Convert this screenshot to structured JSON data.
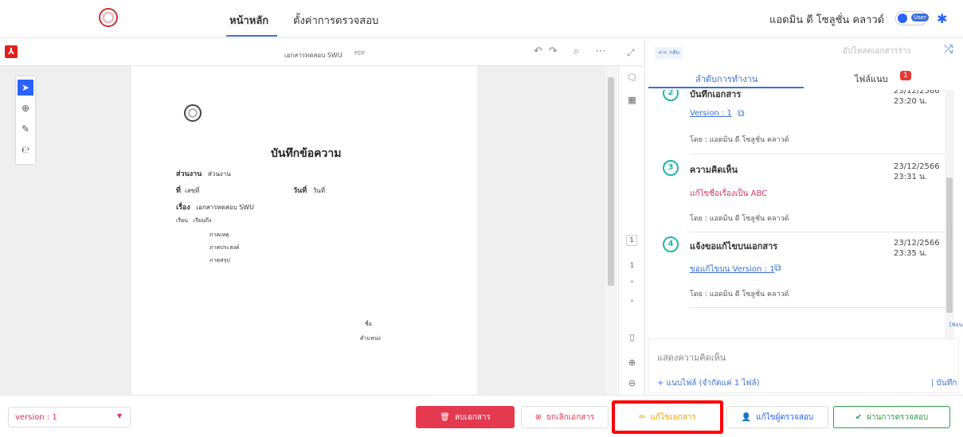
{
  "nav": {
    "home": "หน้าหลัก",
    "settings": "ตั้งค่าการตรวจสอบ",
    "user": "แอดมิน ดี โซลูชั่น คลาวด์",
    "toggle": "User"
  },
  "pdf": {
    "title": "เอกสารทดสอบ SWU",
    "ext": "PDF"
  },
  "doc": {
    "heading": "บันทึกข้อความ",
    "dept_label": "ส่วนงาน",
    "dept_value": "ส่วนงาน",
    "no_label": "ที่",
    "no_value": "เลขที่",
    "date_label": "วันที่",
    "date_value": "วันที่",
    "subject_label": "เรื่อง",
    "subject_value": "เอกสารทดสอบ SWU",
    "to_label": "เรียน",
    "to_value": "เรียนถึง",
    "intro": "ภาคเหตุ",
    "purpose": "ภาคประสงค์",
    "summary": "ภาคสรุป",
    "sign": "ชื่อ",
    "position": "ตำแหน่ง"
  },
  "viewer": {
    "page_num": "1",
    "page_total": "1"
  },
  "right": {
    "back": "<< กลับ",
    "upload_draft": "อัปโหลดเอกสารร่าง",
    "tab_order": "ลำดับการทำงาน",
    "tab_files": "ไฟล์แนบ",
    "files_count": "1",
    "timeline": [
      {
        "num": "2",
        "title": "บันทึกเอกสาร",
        "time": "23/12/2566 23:20 น.",
        "link": "Version : 1",
        "by": "โดย : แอดมิน ดี โซลูชั่น คลาวด์"
      },
      {
        "num": "3",
        "title": "ความคิดเห็น",
        "time": "23/12/2566 23:31 น.",
        "comment": "แก้ไขชื่อเรื่องเป็น ABC",
        "by": "โดย : แอดมิน ดี โซลูชั่น คลาวด์"
      },
      {
        "num": "4",
        "title": "แจ้งขอแก้ไขบนเอกสาร",
        "time": "23/12/2566 23:35 น.",
        "link": "ขอแก้ไขบน Version : 1",
        "by": "โดย : แอดมิน ดี โซลูชั่น คลาวด์"
      }
    ],
    "hide": "[ซ่อน]",
    "comment_placeholder": "แสดงความคิดเห็น",
    "attach": "+  แนบไฟล์ (จำกัดแค่ 1 ไฟล์)",
    "save": "|  บันทึก"
  },
  "bottom": {
    "version": "version : 1",
    "delete": "ลบเอกสาร",
    "cancel": "ยกเลิกเอกสาร",
    "edit": "แก้ไขเอกสาร",
    "edit_reviewer": "แก้ไขผู้ตรวจสอบ",
    "pass": "ผ่านการตรวจสอบ"
  }
}
